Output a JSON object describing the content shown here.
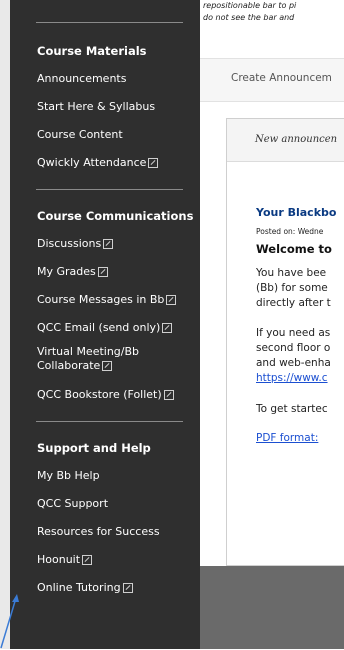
{
  "top_note": {
    "line1": "repositionable bar to pi",
    "line2": "do not see the bar and"
  },
  "tabs": {
    "create_label": "Create Announcem"
  },
  "sidebar": {
    "sections": [
      {
        "title": "Course Materials",
        "items": [
          {
            "label": "Announcements",
            "ext": false
          },
          {
            "label": "Start Here & Syllabus",
            "ext": false
          },
          {
            "label": "Course Content",
            "ext": false
          },
          {
            "label": "Qwickly Attendance",
            "ext": true
          }
        ]
      },
      {
        "title": "Course Communications",
        "items": [
          {
            "label": "Discussions",
            "ext": true
          },
          {
            "label": "My Grades",
            "ext": true
          },
          {
            "label": "Course Messages in Bb",
            "ext": true
          },
          {
            "label": "QCC Email (send only)",
            "ext": true
          },
          {
            "label_line1": "Virtual Meeting/Bb",
            "label_line2": "Collaborate",
            "ext": true
          },
          {
            "label": "QCC Bookstore (Follet)",
            "ext": true
          }
        ]
      },
      {
        "title": "Support and Help",
        "items": [
          {
            "label": "My Bb Help",
            "ext": false
          },
          {
            "label": "QCC Support",
            "ext": false
          },
          {
            "label": "Resources for Success",
            "ext": false
          },
          {
            "label": "Hoonuit",
            "ext": true
          },
          {
            "label": "Online Tutoring",
            "ext": true
          }
        ]
      }
    ]
  },
  "announcement": {
    "header": "New announcen",
    "title": "Your Blackbo",
    "posted": "Posted on: Wedne",
    "welcome": "Welcome to",
    "p1": [
      "You have bee",
      "(Bb) for some",
      "directly after t"
    ],
    "p2": [
      "If you need as",
      "second floor o",
      "and web-enha"
    ],
    "p2_link": "https://www.c",
    "p3": "To get startec",
    "pdf_link": "PDF format:"
  },
  "colors": {
    "sidebar_bg": "#2f2f2f",
    "link": "#1b4fd1",
    "title": "#0a3a82"
  }
}
